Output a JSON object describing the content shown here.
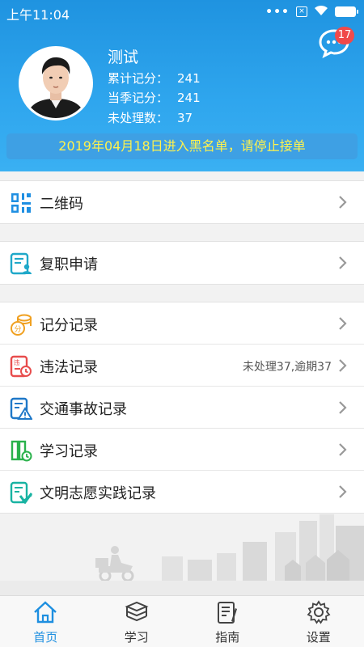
{
  "status_bar": {
    "time": "上午11:04",
    "sim_label": "×"
  },
  "header": {
    "message_badge": "17",
    "user_name": "测试",
    "stats": [
      {
        "label": "累计记分：",
        "value": "241"
      },
      {
        "label": "当季记分：",
        "value": "241"
      },
      {
        "label": "未处理数：",
        "value": "37"
      }
    ],
    "notice": "2019年04月18日进入黑名单，请停止接单"
  },
  "menu": {
    "group1": [
      {
        "label": "二维码",
        "icon": "qr-code-icon"
      }
    ],
    "group2": [
      {
        "label": "复职申请",
        "icon": "reinstatement-doc-icon"
      }
    ],
    "group3": [
      {
        "label": "记分记录",
        "icon": "coins-score-icon"
      },
      {
        "label": "违法记录",
        "icon": "violation-doc-icon",
        "extra": "未处理37,逾期37"
      },
      {
        "label": "交通事故记录",
        "icon": "accident-warning-icon"
      },
      {
        "label": "学习记录",
        "icon": "study-book-icon"
      },
      {
        "label": "文明志愿实践记录",
        "icon": "volunteer-doc-icon"
      }
    ]
  },
  "tabs": [
    {
      "label": "首页",
      "icon": "home-icon",
      "active": true
    },
    {
      "label": "学习",
      "icon": "books-icon",
      "active": false
    },
    {
      "label": "指南",
      "icon": "guide-icon",
      "active": false
    },
    {
      "label": "设置",
      "icon": "gear-icon",
      "active": false
    }
  ],
  "colors": {
    "header_blue": "#2fa6ee",
    "notice_text": "#fff24d",
    "badge_red": "#f04a4a",
    "active_tab": "#1e8fe0"
  }
}
